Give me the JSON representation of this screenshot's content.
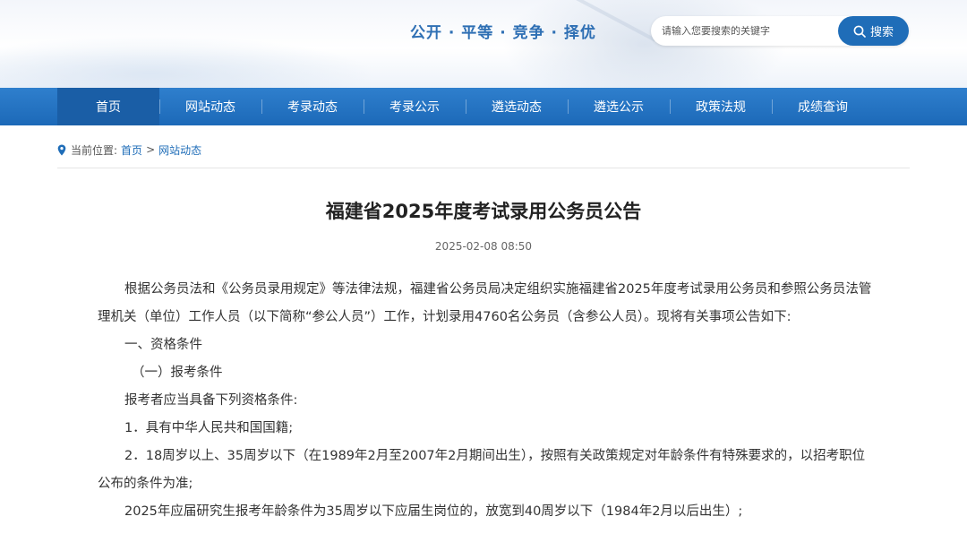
{
  "header": {
    "slogan": "公开 · 平等 · 竞争 · 择优",
    "search": {
      "placeholder": "请输入您要搜索的关键字",
      "button_label": "搜索"
    }
  },
  "nav": {
    "items": [
      {
        "label": "首页",
        "active": true
      },
      {
        "label": "网站动态"
      },
      {
        "label": "考录动态"
      },
      {
        "label": "考录公示"
      },
      {
        "label": "遴选动态"
      },
      {
        "label": "遴选公示"
      },
      {
        "label": "政策法规"
      },
      {
        "label": "成绩查询"
      }
    ]
  },
  "breadcrumb": {
    "prefix": "当前位置:",
    "home": "首页",
    "separator": ">",
    "current": "网站动态"
  },
  "article": {
    "title": "福建省2025年度考试录用公务员公告",
    "date": "2025-02-08 08:50",
    "paragraphs": [
      "根据公务员法和《公务员录用规定》等法律法规，福建省公务员局决定组织实施福建省2025年度考试录用公务员和参照公务员法管理机关（单位）工作人员（以下简称“参公人员”）工作，计划录用4760名公务员（含参公人员）。现将有关事项公告如下:",
      "一、资格条件",
      "（一）报考条件",
      "报考者应当具备下列资格条件:",
      "1．具有中华人民共和国国籍;",
      "2．18周岁以上、35周岁以下（在1989年2月至2007年2月期间出生），按照有关政策规定对年龄条件有特殊要求的，以招考职位公布的条件为准;",
      "2025年应届研究生报考年龄条件为35周岁以下应届生岗位的，放宽到40周岁以下（1984年2月以后出生）;"
    ]
  },
  "colors": {
    "brand_blue": "#1f6db8",
    "nav_active": "#1a5ea6",
    "slogan": "#2e6fb4"
  }
}
